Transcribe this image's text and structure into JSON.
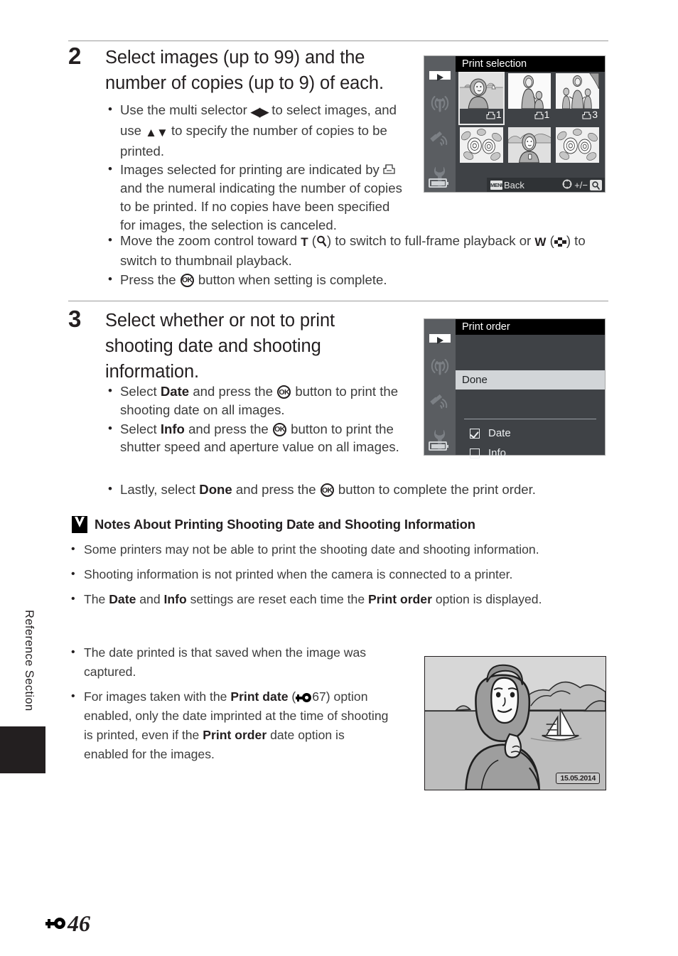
{
  "page": {
    "side_label": "Reference Section",
    "page_number": "46",
    "page_prefix_icon": "nikon-reference-symbol"
  },
  "steps": [
    {
      "number": "2",
      "title": "Select images (up to 99) and the number of copies (up to 9) of each.",
      "bullets": [
        {
          "segments": [
            {
              "t": "text",
              "v": "Use the multi selector "
            },
            {
              "t": "icon",
              "v": "left-right-arrows"
            },
            {
              "t": "text",
              "v": " to select images, and use "
            },
            {
              "t": "icon",
              "v": "up-down-arrows"
            },
            {
              "t": "text",
              "v": " to specify the number of copies to be printed."
            }
          ]
        },
        {
          "segments": [
            {
              "t": "text",
              "v": "Images selected for printing are indicated by "
            },
            {
              "t": "icon",
              "v": "print-order-icon"
            },
            {
              "t": "text",
              "v": " and the numeral indicating the number of copies to be printed. If no copies have been specified for images, the selection is canceled."
            }
          ]
        },
        {
          "segments": [
            {
              "t": "text",
              "v": "Move the zoom control toward "
            },
            {
              "t": "bold",
              "v": "T"
            },
            {
              "t": "text",
              "v": " ("
            },
            {
              "t": "icon",
              "v": "magnifier-icon"
            },
            {
              "t": "text",
              "v": ") to switch to full-frame playback or "
            },
            {
              "t": "bold",
              "v": "W"
            },
            {
              "t": "text",
              "v": " ("
            },
            {
              "t": "icon",
              "v": "thumbnail-grid-icon"
            },
            {
              "t": "text",
              "v": ") to switch to thumbnail playback."
            }
          ]
        },
        {
          "segments": [
            {
              "t": "text",
              "v": "Press the "
            },
            {
              "t": "icon",
              "v": "ok-button-icon"
            },
            {
              "t": "text",
              "v": " button when setting is complete."
            }
          ]
        }
      ]
    },
    {
      "number": "3",
      "title": "Select whether or not to print shooting date and shooting information.",
      "bullets": [
        {
          "segments": [
            {
              "t": "text",
              "v": "Select "
            },
            {
              "t": "bold",
              "v": "Date"
            },
            {
              "t": "text",
              "v": " and press the "
            },
            {
              "t": "icon",
              "v": "ok-button-icon"
            },
            {
              "t": "text",
              "v": " button to print the shooting date on all images."
            }
          ]
        },
        {
          "segments": [
            {
              "t": "text",
              "v": "Select "
            },
            {
              "t": "bold",
              "v": "Info"
            },
            {
              "t": "text",
              "v": " and press the "
            },
            {
              "t": "icon",
              "v": "ok-button-icon"
            },
            {
              "t": "text",
              "v": " button to print the shutter speed and aperture value on all images."
            }
          ]
        },
        {
          "segments": [
            {
              "t": "text",
              "v": "Lastly, select "
            },
            {
              "t": "bold",
              "v": "Done"
            },
            {
              "t": "text",
              "v": " and press the "
            },
            {
              "t": "icon",
              "v": "ok-button-icon"
            },
            {
              "t": "text",
              "v": " button to complete the print order."
            }
          ]
        }
      ]
    }
  ],
  "print_selection_screen": {
    "title": "Print selection",
    "sidebar_icons": [
      "playback-icon",
      "wifi-icon",
      "gps-icon",
      "wrench-setup-icon",
      "battery-icon"
    ],
    "thumbnails": [
      {
        "alt": "woman-at-beach",
        "count": "1",
        "selected": true,
        "show_count": true
      },
      {
        "alt": "woman-with-child",
        "count": "1",
        "selected": false,
        "show_count": true
      },
      {
        "alt": "woman-with-two-children",
        "count": "3",
        "selected": false,
        "show_count": true
      },
      {
        "alt": "flowers",
        "count": "",
        "selected": false,
        "show_count": false
      },
      {
        "alt": "portrait-woman",
        "count": "",
        "selected": false,
        "show_count": false
      },
      {
        "alt": "flowers-2",
        "count": "",
        "selected": false,
        "show_count": false
      }
    ],
    "bottom_left_key": "MENU",
    "bottom_left_label": "Back",
    "bottom_right_label": "+/−",
    "bottom_right_icon": "magnifier-key-icon"
  },
  "print_order_screen": {
    "title": "Print order",
    "sidebar_icons": [
      "playback-icon",
      "wifi-icon",
      "gps-icon",
      "wrench-setup-icon",
      "battery-icon"
    ],
    "done_label": "Done",
    "options": [
      {
        "label": "Date",
        "checked": true
      },
      {
        "label": "Info",
        "checked": false
      }
    ]
  },
  "note": {
    "icon": "caution-checkmark-icon",
    "title": "Notes About Printing Shooting Date and Shooting Information",
    "items": [
      {
        "segments": [
          {
            "t": "text",
            "v": "Some printers may not be able to print the shooting date and shooting information."
          }
        ]
      },
      {
        "segments": [
          {
            "t": "text",
            "v": "Shooting information is not printed when the camera is connected to a printer."
          }
        ]
      },
      {
        "segments": [
          {
            "t": "text",
            "v": "The "
          },
          {
            "t": "bold",
            "v": "Date"
          },
          {
            "t": "text",
            "v": " and "
          },
          {
            "t": "bold",
            "v": "Info"
          },
          {
            "t": "text",
            "v": " settings are reset each time the "
          },
          {
            "t": "bold",
            "v": "Print order"
          },
          {
            "t": "text",
            "v": " option is displayed."
          }
        ]
      },
      {
        "segments": [
          {
            "t": "text",
            "v": "The date printed is that saved when the image was captured."
          }
        ]
      },
      {
        "segments": [
          {
            "t": "text",
            "v": "For images taken with the "
          },
          {
            "t": "bold",
            "v": "Print date"
          },
          {
            "t": "text",
            "v": " ("
          },
          {
            "t": "icon",
            "v": "nikon-reference-symbol"
          },
          {
            "t": "text",
            "v": "67) option enabled, only the date imprinted at the time of shooting is printed, even if the "
          },
          {
            "t": "bold",
            "v": "Print order"
          },
          {
            "t": "text",
            "v": " date option is enabled for the images."
          }
        ]
      }
    ]
  },
  "photo_illustration": {
    "alt": "woman-by-the-sea-with-sailboat",
    "date_stamp": "15.05.2014"
  }
}
